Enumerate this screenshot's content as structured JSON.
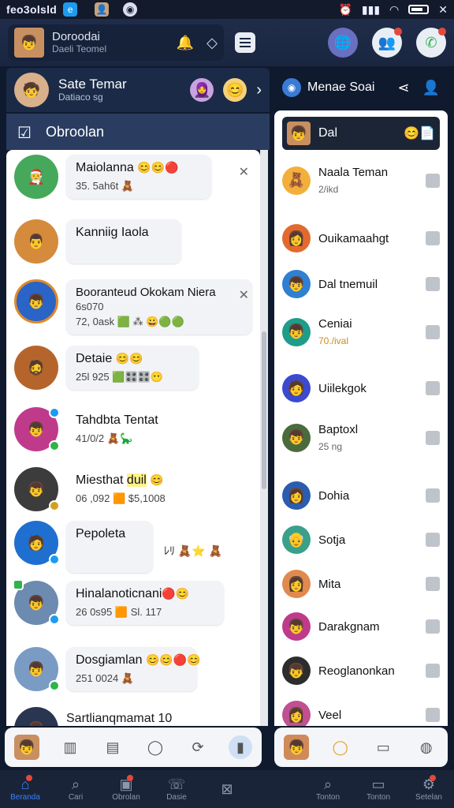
{
  "status_bar": {
    "app_title": "feo3olsld",
    "app_icon": "e"
  },
  "top_card": {
    "name": "Doroodai",
    "sub": "Daeli Teomel"
  },
  "left_header": {
    "name": "Sate Temar",
    "sub": "Datiaco sg"
  },
  "chats_tab": {
    "label": "Obroolan"
  },
  "chats": [
    {
      "name": "Maiolanna",
      "emojis": "😊😊🔴",
      "meta": "35. 5ah6t",
      "emoji2": "🧸"
    },
    {
      "name": "Kanniig Iaola",
      "emojis": "",
      "meta": "",
      "emoji2": ""
    },
    {
      "name": "Booranteud Okokam Niera",
      "emojis": "",
      "meta": "6s070",
      "meta2": "72, 0ask",
      "emoji2": "🟩 ⁂ 😀🟢🟢"
    },
    {
      "name": "Detaie",
      "emojis": "😊😊",
      "meta": "25l 925",
      "emoji2": "🟩🎛️🎛️😶"
    },
    {
      "name": "Tahdbta Tentat",
      "emojis": "",
      "meta": "41/0/2",
      "emoji2": "🧸🦕"
    },
    {
      "name": "Miesthat",
      "highlight": "duil",
      "emojis": "😊",
      "meta": "06 ,092",
      "emoji2": "🟧 $5,1008"
    },
    {
      "name": "Pepoleta",
      "emojis": "",
      "meta": "",
      "emoji2": "ﾚﾘ 🧸⭐ 🧸"
    },
    {
      "name": "Hinalanoticnani",
      "emojis": "🔴😊",
      "meta": "26 0s95",
      "emoji2": "🟧 Sl. 117"
    },
    {
      "name": "Dosgiamlan",
      "emojis": "😊😊🔴😊",
      "meta": "251 0024",
      "emoji2": "🧸"
    },
    {
      "name": "Sartlianqmamat 10",
      "emojis": "",
      "meta": "",
      "emoji2": ""
    }
  ],
  "right_header": {
    "title": "Menae Soai"
  },
  "right_top": {
    "name": "Dal"
  },
  "contacts": [
    {
      "name": "Naala Teman",
      "sub": "2/ikd",
      "orange": false
    },
    {
      "name": "Ouikamaahgt",
      "sub": "",
      "orange": false
    },
    {
      "name": "Dal tnemuil",
      "sub": "",
      "orange": false
    },
    {
      "name": "Ceniai",
      "sub": "70./ival",
      "orange": true
    },
    {
      "name": "Uiilekgok",
      "sub": "",
      "orange": false
    },
    {
      "name": "Baptoxl",
      "sub": "25 ng",
      "orange": false
    },
    {
      "name": "Dohia",
      "sub": "",
      "orange": false
    },
    {
      "name": "Sotja",
      "sub": "",
      "orange": false
    },
    {
      "name": "Mita",
      "sub": "",
      "orange": false
    },
    {
      "name": "Darakgnam",
      "sub": "",
      "orange": false
    },
    {
      "name": "Reoglanonkan",
      "sub": "",
      "orange": false
    },
    {
      "name": "Veel",
      "sub": "",
      "orange": false
    }
  ],
  "nav": [
    {
      "label": "Beranda",
      "icon": "home-icon",
      "active": true,
      "dot": true
    },
    {
      "label": "Cari",
      "icon": "search-icon",
      "active": false,
      "dot": false
    },
    {
      "label": "Obrolan",
      "icon": "chat-icon",
      "active": false,
      "dot": true
    },
    {
      "label": "Dasie",
      "icon": "call-icon",
      "active": false,
      "dot": false
    },
    {
      "label": "",
      "icon": "grid-icon",
      "active": false,
      "dot": false
    },
    {
      "label": "",
      "icon": "",
      "active": false,
      "dot": false
    },
    {
      "label": "Tonton",
      "icon": "search-icon",
      "active": false,
      "dot": false
    },
    {
      "label": "Tonton",
      "icon": "video-icon",
      "active": false,
      "dot": false
    },
    {
      "label": "Setelan",
      "icon": "settings-icon",
      "active": false,
      "dot": true
    }
  ],
  "colors": {
    "header": "#1b2a47",
    "accent": "#3b82f6",
    "online": "#2fb34a",
    "verified": "#1d9bf0",
    "alert": "#e5483a"
  }
}
